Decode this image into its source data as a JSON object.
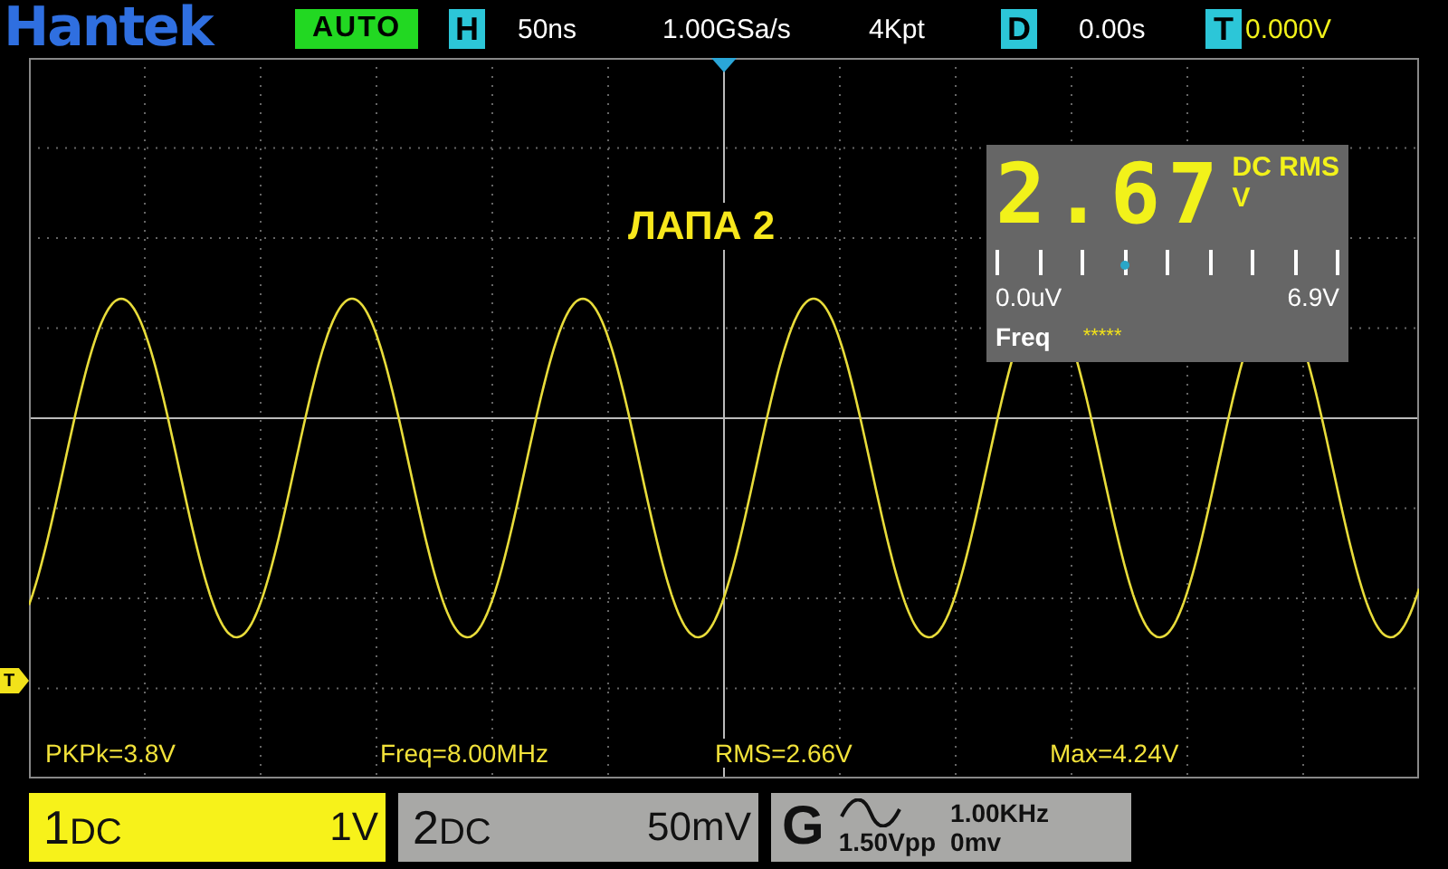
{
  "header": {
    "logo": "Hantek",
    "mode": "AUTO",
    "horizontal": {
      "badge": "H",
      "timebase": "50ns"
    },
    "sample_rate": "1.00GSa/s",
    "memory_depth": "4Kpt",
    "delay": {
      "badge": "D",
      "value": "0.00s"
    },
    "trigger": {
      "badge": "T",
      "level": "0.000V"
    }
  },
  "screen": {
    "annotation": "ЛАПА 2",
    "trigger_marker": "T",
    "meter": {
      "digits": "2.67",
      "mode": "DC RMS",
      "unit": "V",
      "scale_min": "0.0uV",
      "scale_max": "6.9V",
      "label": "Freq",
      "freq_value": "*****",
      "level": 0.38
    },
    "measurements": [
      "PKPk=3.8V",
      "Freq=8.00MHz",
      "RMS=2.66V",
      "Max=4.24V"
    ]
  },
  "channels": [
    {
      "number": "1",
      "coupling": "DC",
      "scale": "1V",
      "active": true
    },
    {
      "number": "2",
      "coupling": "DC",
      "scale": "50mV",
      "active": false
    }
  ],
  "generator": {
    "badge": "G",
    "frequency": "1.00KHz",
    "amplitude": "1.50Vpp",
    "offset": "0mv"
  }
}
